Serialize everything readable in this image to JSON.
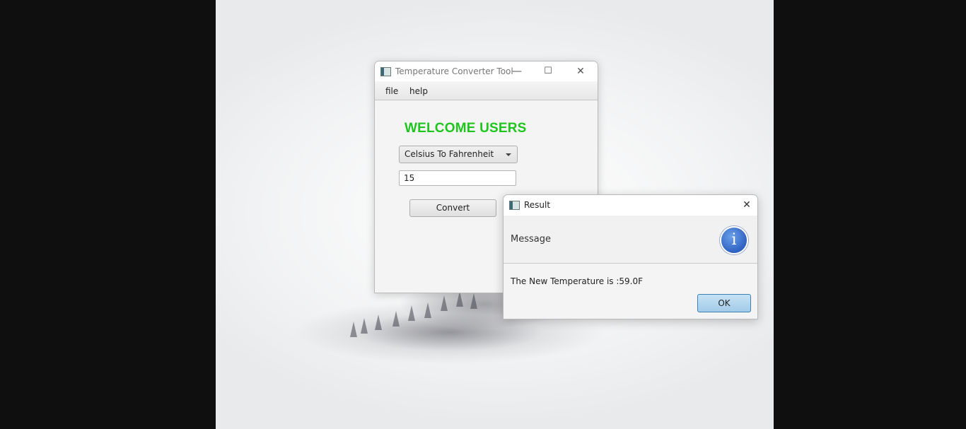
{
  "main_window": {
    "title": "Temperature Converter Tool",
    "menu": [
      "file",
      "help"
    ],
    "welcome_text": "WELCOME USERS",
    "conversion_select": {
      "value": "Celsius To Fahrenheit"
    },
    "temperature_input": {
      "value": "15"
    },
    "convert_label": "Convert",
    "controls": {
      "minimize": "—",
      "maximize": "☐",
      "close": "✕"
    }
  },
  "dialog": {
    "title": "Result",
    "header_text": "Message",
    "icon": "info-icon",
    "icon_glyph": "i",
    "content": "The New Temperature is :59.0F",
    "ok_label": "OK",
    "close": "✕"
  },
  "colors": {
    "welcome": "#1fc51f",
    "ok_button": "#a3cbe8",
    "info_icon": "#2f62c2"
  }
}
